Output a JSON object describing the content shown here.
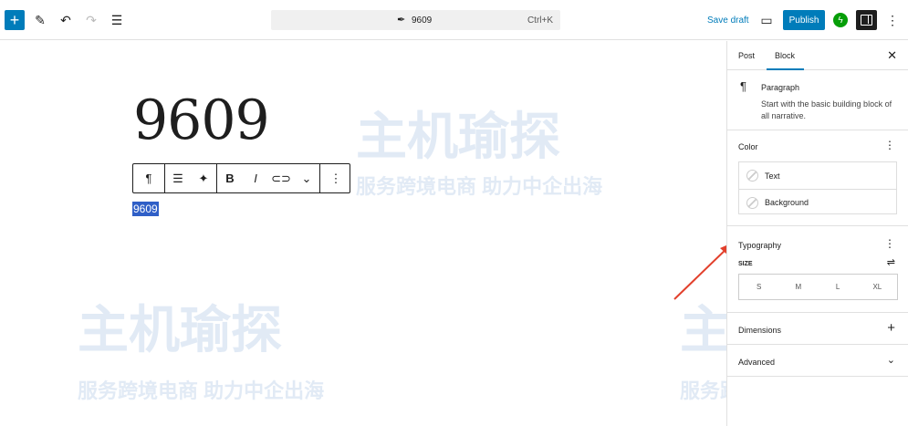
{
  "topbar": {
    "doc_title": "9609",
    "shortcut": "Ctrl+K",
    "save_draft": "Save draft",
    "publish": "Publish"
  },
  "editor": {
    "post_title": "9609",
    "paragraph_text": "9609"
  },
  "sidebar": {
    "tabs": [
      "Post",
      "Block"
    ],
    "block": {
      "name": "Paragraph",
      "description": "Start with the basic building block of all narrative."
    },
    "color": {
      "title": "Color",
      "items": [
        "Text",
        "Background"
      ]
    },
    "typography": {
      "title": "Typography",
      "size_label": "SIZE",
      "sizes": [
        "S",
        "M",
        "L",
        "XL"
      ]
    },
    "dimensions": "Dimensions",
    "advanced": "Advanced"
  },
  "watermark": {
    "brand": "主机瑜探",
    "slogan": "服务跨境电商 助力中企出海"
  },
  "colors": {
    "accent": "#007cba",
    "selection": "#2f5fc7",
    "annotation_arrow": "#e2402c"
  }
}
